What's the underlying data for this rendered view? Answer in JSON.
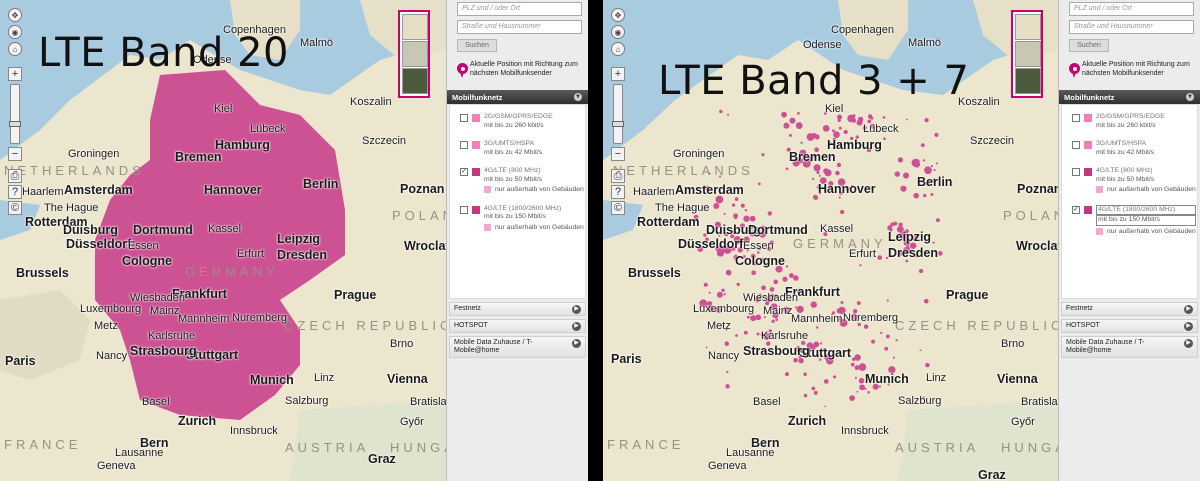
{
  "panels": [
    {
      "title": "LTE Band 20",
      "cities": [
        "Copenhagen",
        "Malmö",
        "Odense",
        "Koszalin",
        "Szczecin",
        "Groningen",
        "Bremen",
        "Hamburg",
        "Hannover",
        "Berlin",
        "Poznan",
        "Amsterdam",
        "Rotterdam",
        "The Hague",
        "Haarlem",
        "Duisburg",
        "Dortmund",
        "Düsseldorf",
        "Essen",
        "Cologne",
        "Leipzig",
        "Dresden",
        "Wroclaw",
        "Brussels",
        "Frankfurt",
        "Prague",
        "Stuttgart",
        "Nuremberg",
        "Munich",
        "Paris",
        "Vienna",
        "Zurich",
        "Basel",
        "Geneva",
        "Linz",
        "Graz",
        "Brno",
        "Bern",
        "Lausanne",
        "Luxembourg",
        "Nancy",
        "Metz",
        "Strasbourg",
        "Kiel",
        "Lübeck",
        "Erfurt",
        "Kassel",
        "Mainz",
        "Wiesbaden",
        "Mannheim",
        "Karlsruhe",
        "Salzburg",
        "Innsbruck",
        "Győr",
        "Bratislava"
      ],
      "countries": [
        "NETHERLANDS",
        "GERMANY",
        "POLAND",
        "CZECH REPUBLIC",
        "AUSTRIA",
        "HUNGARY",
        "FRANCE"
      ],
      "sidebar": {
        "search_placeholder": "PLZ und / oder Ort",
        "street_placeholder": "Straße und Hausnummer",
        "search_button": "Suchen",
        "locate_text": "Aktuelle Position mit Richtung zum nächsten Mobilfunksender",
        "section_title": "Mobilfunknetz",
        "network_items": [
          {
            "checked": false,
            "swatch": "#f080b8",
            "line1": "2G/GSM/GPRS/EDGE",
            "line2": "mit bis zu 260 kbit/s",
            "sub": ""
          },
          {
            "checked": false,
            "swatch": "#f080b8",
            "line1": "3G/UMTS/HSPA",
            "line2": "mit bis zu 42 Mbit/s",
            "sub": ""
          },
          {
            "checked": true,
            "swatch": "#c13a7f",
            "line1": "4G/LTE (800 MHz)",
            "line2": "mit bis zu 50 Mbit/s",
            "sub": "nur außerhalb von Gebäuden"
          },
          {
            "checked": false,
            "swatch": "#c13a7f",
            "line1": "4G/LTE (1800/2600 MHz)",
            "line2": "mit bis zu 150 Mbit/s",
            "sub": "nur außerhalb von Gebäuden"
          }
        ],
        "rows": [
          "Festnetz",
          "HOTSPOT",
          "Mobile Data Zuhause / T-Mobile@home"
        ]
      }
    },
    {
      "title": "LTE Band 3 + 7",
      "sidebar": {
        "search_placeholder": "PLZ und / oder Ort",
        "street_placeholder": "Straße und Hausnummer",
        "search_button": "Suchen",
        "locate_text": "Aktuelle Position mit Richtung zum nächsten Mobilfunksender",
        "section_title": "Mobilfunknetz",
        "network_items": [
          {
            "checked": false,
            "swatch": "#f080b8",
            "line1": "2G/GSM/GPRS/EDGE",
            "line2": "mit bis zu 260 kbit/s",
            "sub": ""
          },
          {
            "checked": false,
            "swatch": "#f080b8",
            "line1": "3G/UMTS/HSPA",
            "line2": "mit bis zu 42 Mbit/s",
            "sub": ""
          },
          {
            "checked": false,
            "swatch": "#c13a7f",
            "line1": "4G/LTE (800 MHz)",
            "line2": "mit bis zu 50 Mbit/s",
            "sub": "nur außerhalb von Gebäuden"
          },
          {
            "checked": true,
            "swatch": "#c13a7f",
            "line1": "4G/LTE (1800/2600 MHz)",
            "line2": "mit bis zu 150 Mbit/s",
            "sub": "nur außerhalb von Gebäuden"
          }
        ],
        "rows": [
          "Festnetz",
          "HOTSPOT",
          "Mobile Data Zuhause / T-Mobile@home"
        ]
      }
    }
  ],
  "colors": {
    "coverage": "#c8378a",
    "accent": "#c8006e",
    "land": "#ece6cf",
    "sea": "#a8cbe0"
  }
}
